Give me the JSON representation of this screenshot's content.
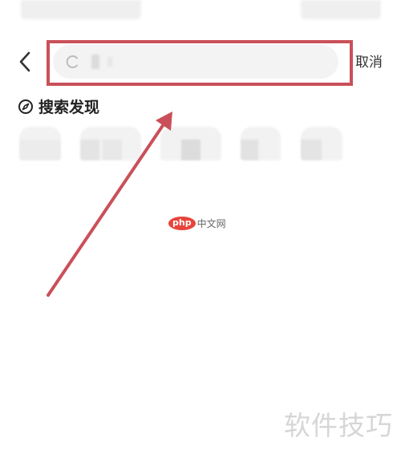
{
  "header": {
    "cancel_label": "取消"
  },
  "search": {
    "placeholder": ""
  },
  "discover": {
    "title": "搜索发现"
  },
  "watermark": {
    "logo": "php",
    "site": "中文网",
    "caption": "软件技巧"
  },
  "colors": {
    "highlight": "#c9505a",
    "arrow": "#c9505a",
    "search_bg": "#f3f3f3",
    "logo_bg": "#e8443b"
  },
  "icons": {
    "back": "chevron-left-icon",
    "search": "search-icon",
    "discover": "compass-icon"
  }
}
